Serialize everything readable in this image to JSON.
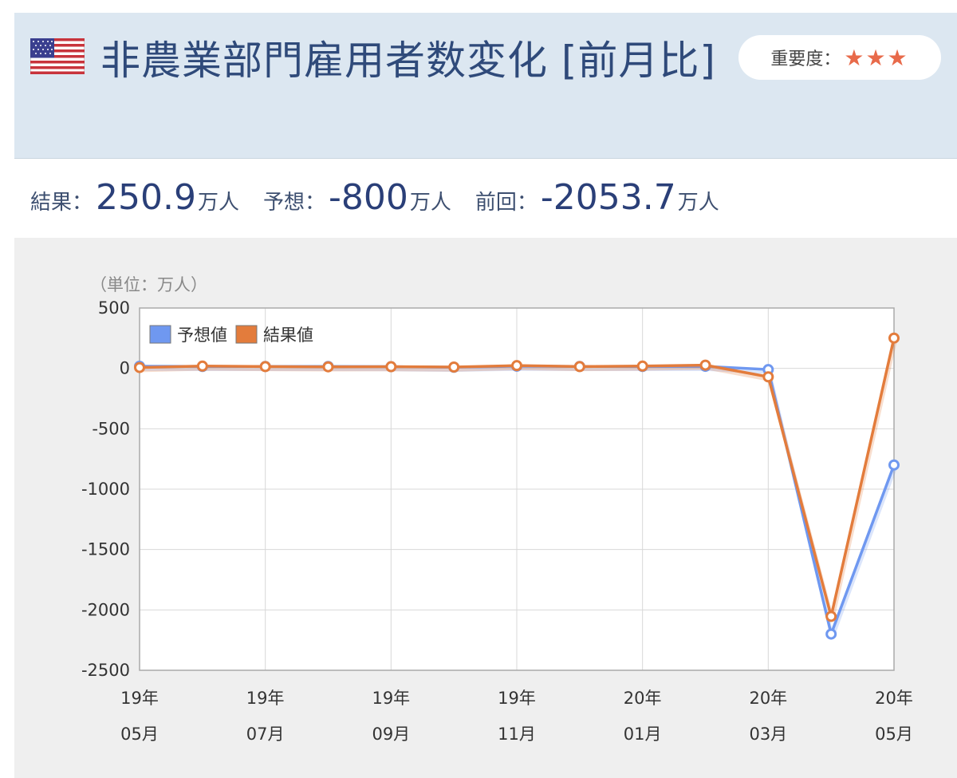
{
  "header": {
    "title": "非農業部門雇用者数変化 [前月比]",
    "importance_label": "重要度：",
    "importance_stars": "★★★",
    "flag_icon": "us-flag-icon"
  },
  "stats": [
    {
      "label": "結果：",
      "value": "250.9",
      "unit": "万人"
    },
    {
      "label": "予想：",
      "value": "-800",
      "unit": "万人"
    },
    {
      "label": "前回：",
      "value": "-2053.7",
      "unit": "万人"
    }
  ],
  "chart_data": {
    "type": "line",
    "unit_label": "（単位：万人）",
    "x": [
      "19年05月",
      "19年06月",
      "19年07月",
      "19年08月",
      "19年09月",
      "19年10月",
      "19年11月",
      "19年12月",
      "20年01月",
      "20年02月",
      "20年03月",
      "20年04月",
      "20年05月"
    ],
    "tick_labels": [
      {
        "index": 0,
        "line1": "19年",
        "line2": "05月"
      },
      {
        "index": 2,
        "line1": "19年",
        "line2": "07月"
      },
      {
        "index": 4,
        "line1": "19年",
        "line2": "09月"
      },
      {
        "index": 6,
        "line1": "19年",
        "line2": "11月"
      },
      {
        "index": 8,
        "line1": "20年",
        "line2": "01月"
      },
      {
        "index": 10,
        "line1": "20年",
        "line2": "03月"
      },
      {
        "index": 12,
        "line1": "20年",
        "line2": "05月"
      }
    ],
    "series": [
      {
        "name": "予想値",
        "color": "#6f98f0",
        "values": [
          18,
          16,
          16,
          16,
          14,
          9,
          18,
          16,
          16,
          17,
          -10,
          -2200,
          -800
        ]
      },
      {
        "name": "結果値",
        "color": "#e37c3c",
        "values": [
          7,
          19,
          15,
          13,
          14,
          11,
          23,
          15,
          19,
          27,
          -70,
          -2053.7,
          250.9
        ]
      }
    ],
    "ylim": [
      -2500,
      500
    ],
    "yticks": [
      500,
      0,
      -500,
      -1000,
      -1500,
      -2000,
      -2500
    ],
    "grid": true,
    "legend_position": "top-left"
  }
}
